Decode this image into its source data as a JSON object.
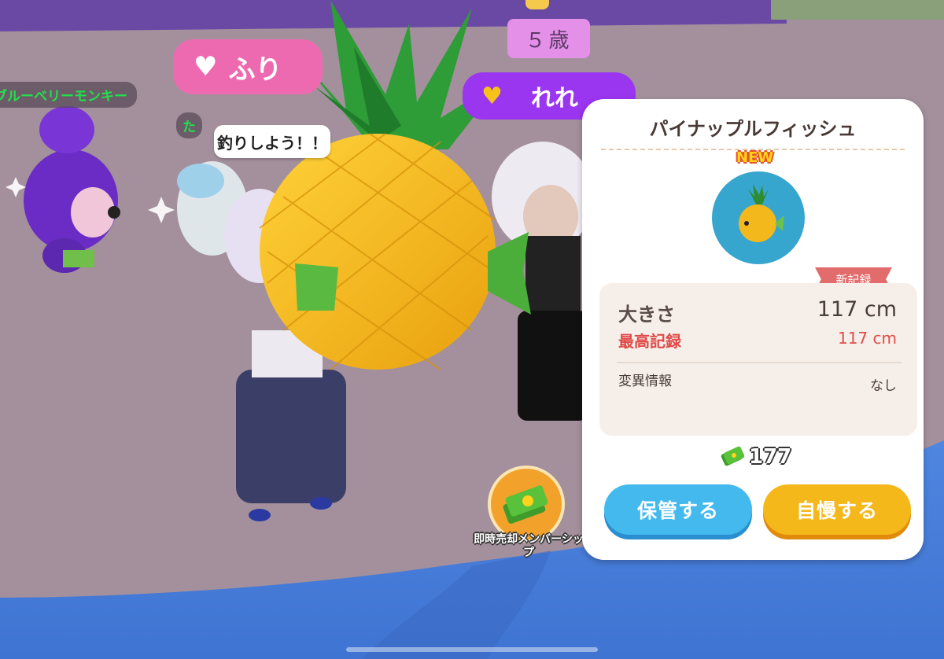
{
  "scene": {
    "age_tag": "５歳",
    "pink_tag_name": "ふり",
    "purple_tag_name": "れれ",
    "monkey_name": "ブルーベリーモンキー",
    "partial_name": "た",
    "speech_bubble": "釣りしよう！！"
  },
  "instant_sell": {
    "label": "即時売却メンバーシップ"
  },
  "result_panel": {
    "title": "パイナップルフィッシュ",
    "new_badge": "NEW",
    "record_ribbon": "新記録",
    "stats": {
      "size_label": "大きさ",
      "size_value": "117 cm",
      "best_label": "最高記録",
      "best_value": "117 cm",
      "mutation_label": "変異情報",
      "mutation_value": "なし"
    },
    "price": "177",
    "buttons": {
      "store": "保管する",
      "brag": "自慢する"
    }
  },
  "colors": {
    "accent_blue": "#43b9ee",
    "accent_yellow": "#f5b81a",
    "record_red": "#e04a4a",
    "name_pink": "#ee6ab0",
    "name_purple": "#9a35f0"
  }
}
